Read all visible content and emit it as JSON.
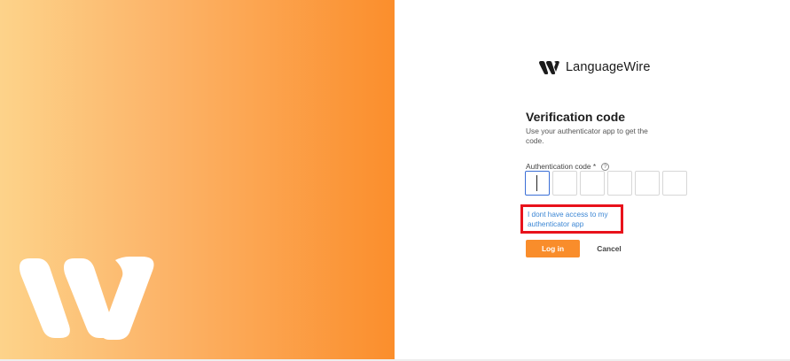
{
  "brand": {
    "name": "LanguageWire",
    "logo_icon": "languagewire-logo-icon"
  },
  "colors": {
    "accent": "#f98d2b",
    "link": "#3b86d4",
    "highlight": "#e8121b",
    "gradient_start": "#fdd38a",
    "gradient_end": "#fb8e2c"
  },
  "form": {
    "title": "Verification code",
    "subtitle": "Use your authenticator app to get the code.",
    "field_label": "Authentication code *",
    "help_icon": "question-circle-icon",
    "help_glyph": "?",
    "code_length": 6,
    "no_access_link": "I dont have access to my authenticator app",
    "login_label": "Log in",
    "cancel_label": "Cancel"
  }
}
